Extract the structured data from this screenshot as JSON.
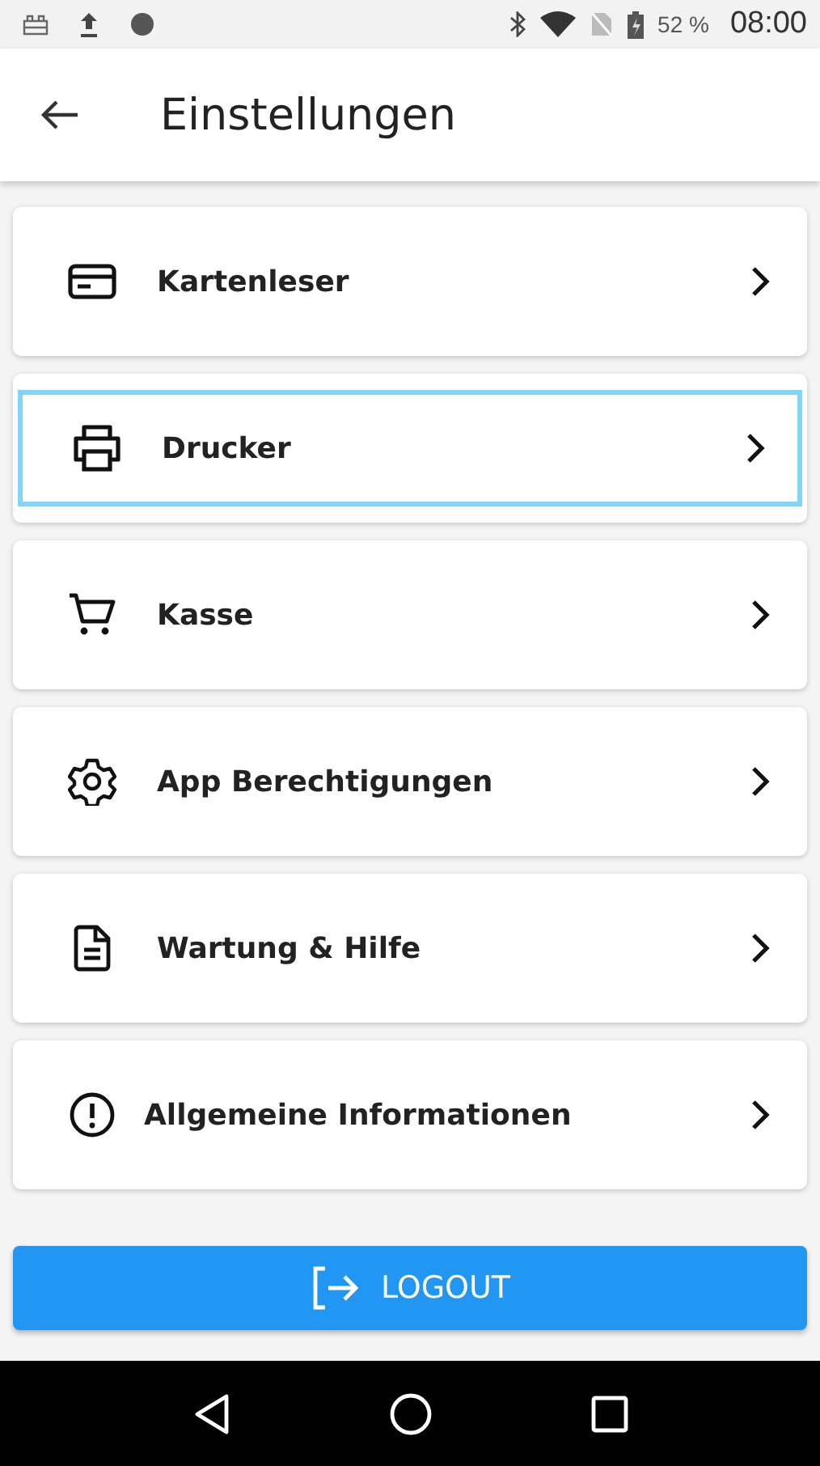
{
  "status_bar": {
    "battery": "52 %",
    "time": "08:00"
  },
  "header": {
    "title": "Einstellungen"
  },
  "items": [
    {
      "label": "Kartenleser",
      "selected": false
    },
    {
      "label": "Drucker",
      "selected": true
    },
    {
      "label": "Kasse",
      "selected": false
    },
    {
      "label": "App Berechtigungen",
      "selected": false
    },
    {
      "label": "Wartung & Hilfe",
      "selected": false
    },
    {
      "label": "Allgemeine Informationen",
      "selected": false
    }
  ],
  "logout_button": {
    "label": "LOGOUT"
  }
}
